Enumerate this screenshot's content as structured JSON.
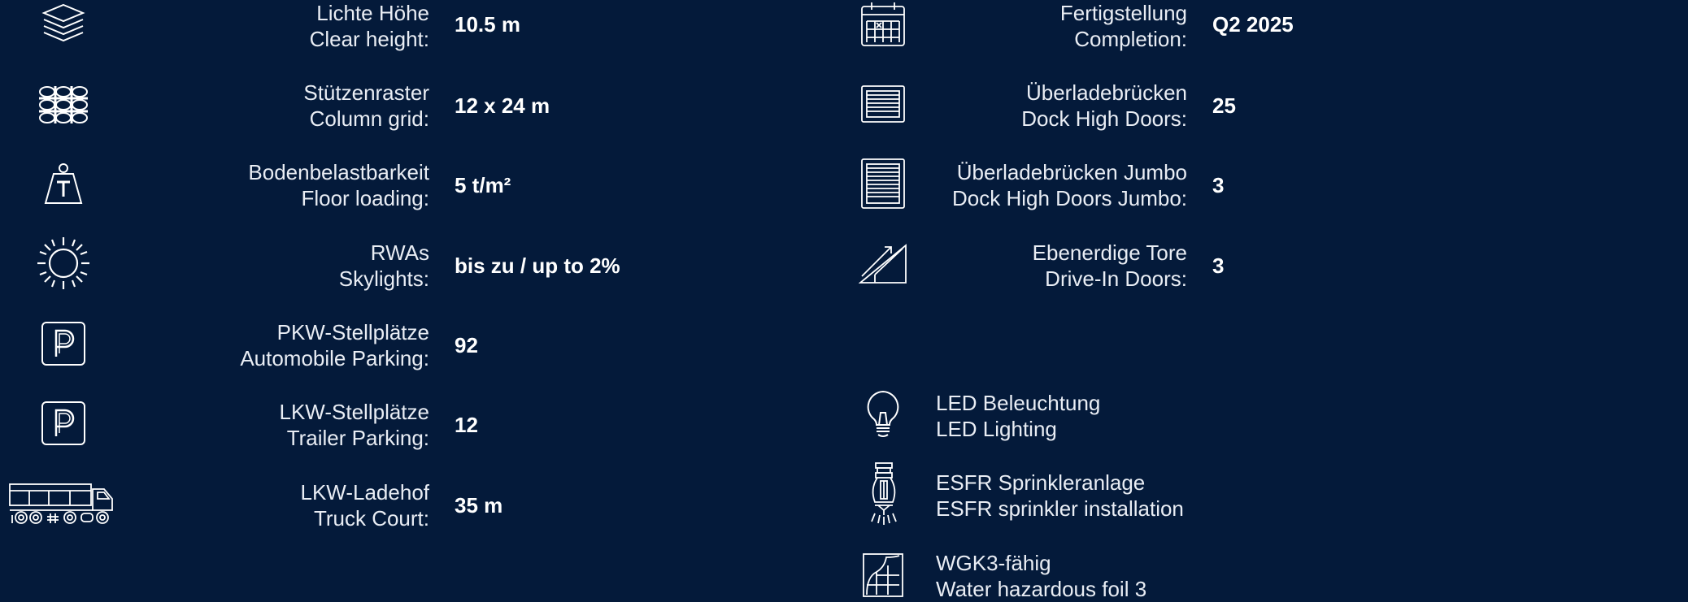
{
  "left_specs": [
    {
      "icon": "stack-layers-icon",
      "de": "Lichte Höhe",
      "en": "Clear height:",
      "value": "10.5 m"
    },
    {
      "icon": "column-grid-icon",
      "de": "Stützenraster",
      "en": "Column grid:",
      "value": "12 x 24 m"
    },
    {
      "icon": "weight-icon",
      "de": "Bodenbelastbarkeit",
      "en": "Floor loading:",
      "value": "5 t/m²"
    },
    {
      "icon": "sun-icon",
      "de": "RWAs",
      "en": "Skylights:",
      "value": "bis zu / up to 2%"
    },
    {
      "icon": "parking-icon",
      "de": "PKW-Stellplätze",
      "en": "Automobile Parking:",
      "value": "92"
    },
    {
      "icon": "parking-icon",
      "de": "LKW-Stellplätze",
      "en": "Trailer Parking:",
      "value": "12"
    },
    {
      "icon": "truck-icon",
      "de": "LKW-Ladehof",
      "en": "Truck Court:",
      "value": "35 m"
    }
  ],
  "right_specs": [
    {
      "icon": "calendar-icon",
      "de": "Fertigstellung",
      "en": "Completion:",
      "value": "Q2 2025"
    },
    {
      "icon": "dock-door-icon",
      "de": "Überladebrücken",
      "en": "Dock High Doors:",
      "value": "25"
    },
    {
      "icon": "jumbo-dock-door-icon",
      "de": "Überladebrücken Jumbo",
      "en": "Dock High Doors Jumbo:",
      "value": "3"
    },
    {
      "icon": "ramp-door-icon",
      "de": "Ebenerdige Tore",
      "en": "Drive-In Doors:",
      "value": "3"
    }
  ],
  "features": [
    {
      "icon": "lightbulb-icon",
      "de": "LED Beleuchtung",
      "en": "LED Lighting"
    },
    {
      "icon": "sprinkler-icon",
      "de": "ESFR Sprinkleranlage",
      "en": "ESFR sprinkler installation"
    },
    {
      "icon": "hazard-foil-icon",
      "de": "WGK3-fähig",
      "en": "Water hazardous foil 3"
    }
  ]
}
